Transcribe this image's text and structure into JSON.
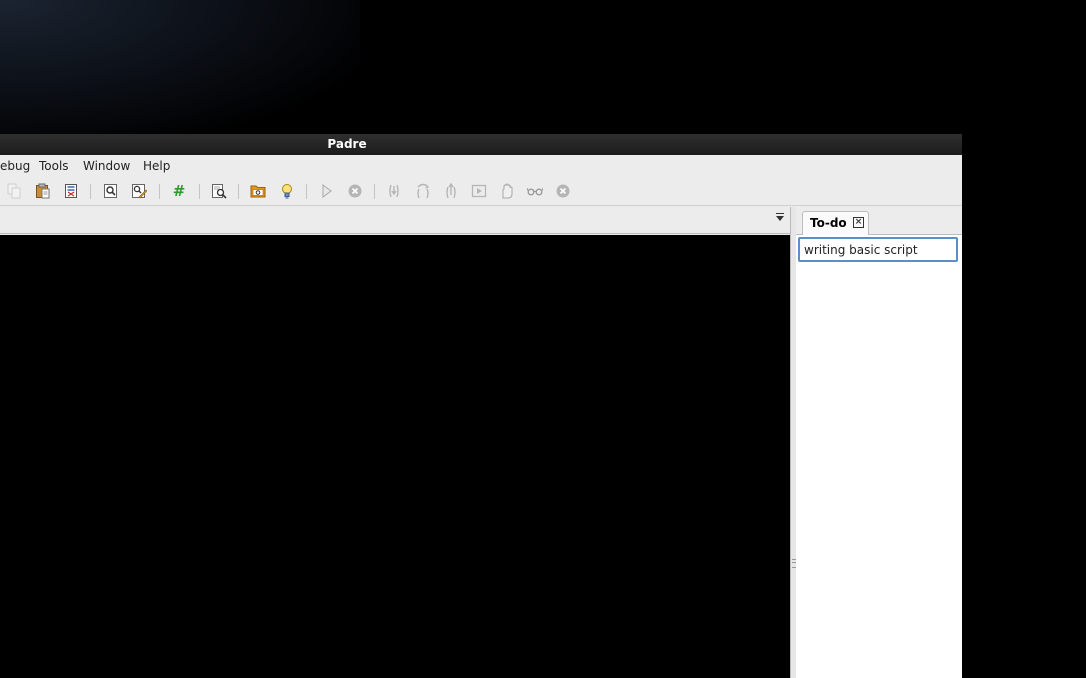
{
  "window": {
    "title": "Padre"
  },
  "menu": [
    "ebug",
    "Tools",
    "Window",
    "Help"
  ],
  "toolbar": {
    "icons": [
      "copy-icon",
      "paste-icon",
      "select-all-icon",
      "find-icon",
      "replace-icon",
      "comment-icon",
      "search-in-files-icon",
      "open-folder-icon",
      "idea-icon",
      "run-icon",
      "stop-icon",
      "step-in-icon",
      "step-over-icon",
      "step-out-icon",
      "run-till-breakpoint-icon",
      "breakpoint-hand-icon",
      "watch-icon",
      "quit-debugger-icon"
    ]
  },
  "todo_panel": {
    "tab_label": "To-do",
    "filter_value": "writing basic script"
  },
  "colors": {
    "titlebar": "#262626",
    "chrome": "#ececec",
    "editor_bg": "#000000",
    "input_focus_border": "#5b8fc9",
    "comment_green": "#2e9b2e",
    "folder_orange": "#e69a1c"
  }
}
